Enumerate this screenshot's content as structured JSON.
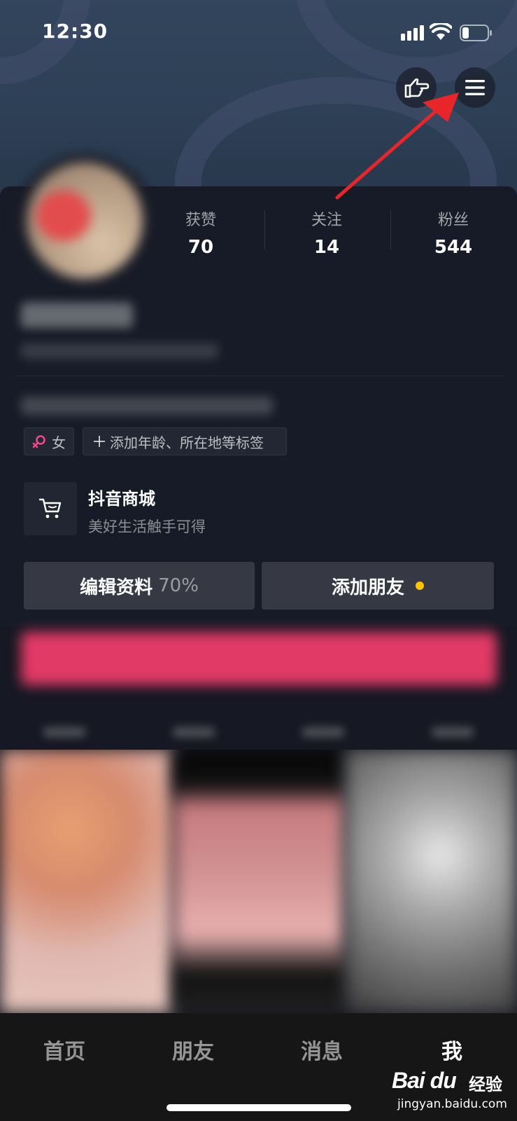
{
  "status": {
    "time": "12:30"
  },
  "stats": [
    {
      "label": "获赞",
      "value": "70"
    },
    {
      "label": "关注",
      "value": "14"
    },
    {
      "label": "粉丝",
      "value": "544"
    }
  ],
  "tags": {
    "gender": "女",
    "add": "添加年龄、所在地等标签"
  },
  "mall": {
    "title": "抖音商城",
    "subtitle": "美好生活触手可得"
  },
  "actions": {
    "edit_label": "编辑资料",
    "edit_percent": "70%",
    "add_friend_label": "添加朋友"
  },
  "bottom_nav": [
    {
      "label": "首页"
    },
    {
      "label": "朋友"
    },
    {
      "label": "消息"
    },
    {
      "label": "我"
    }
  ],
  "watermark": {
    "logo": "Bai du",
    "cn": "经验",
    "url": "jingyan.baidu.com"
  },
  "colors": {
    "accent_dot": "#ffc300",
    "arrow": "#e8262a",
    "gender_icon": "#f0498b",
    "banner": "#e23a67"
  },
  "icons": [
    "signal-icon",
    "wifi-icon",
    "battery-icon",
    "pointing-hand-icon",
    "menu-icon",
    "female-icon",
    "cart-icon",
    "red-arrow-annotation"
  ]
}
